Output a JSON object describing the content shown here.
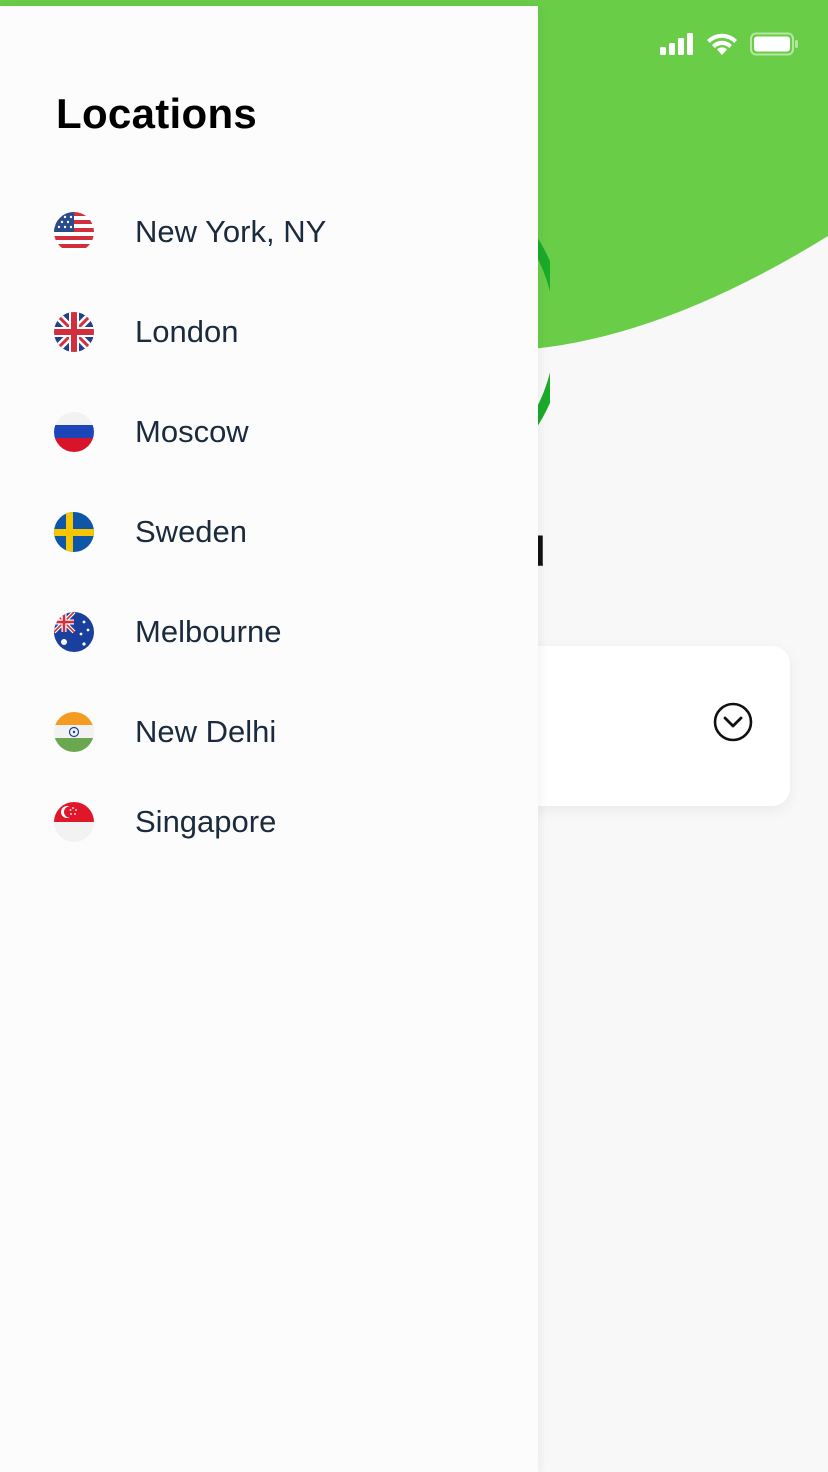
{
  "drawer": {
    "title": "Locations",
    "locations": [
      {
        "label": "New York, NY",
        "flag_icon": "us-flag-icon"
      },
      {
        "label": "London",
        "flag_icon": "uk-flag-icon"
      },
      {
        "label": "Moscow",
        "flag_icon": "russia-flag-icon"
      },
      {
        "label": "Sweden",
        "flag_icon": "sweden-flag-icon"
      },
      {
        "label": "Melbourne",
        "flag_icon": "australia-flag-icon"
      },
      {
        "label": "New Delhi",
        "flag_icon": "india-flag-icon"
      },
      {
        "label": "Singapore",
        "flag_icon": "singapore-flag-icon"
      }
    ]
  },
  "background": {
    "heading_fragment": "d",
    "accent_color": "#6acd48",
    "ring_color": "#1aab2b"
  },
  "status_bar": {
    "icons": [
      "signal-icon",
      "wifi-icon",
      "battery-icon"
    ]
  }
}
